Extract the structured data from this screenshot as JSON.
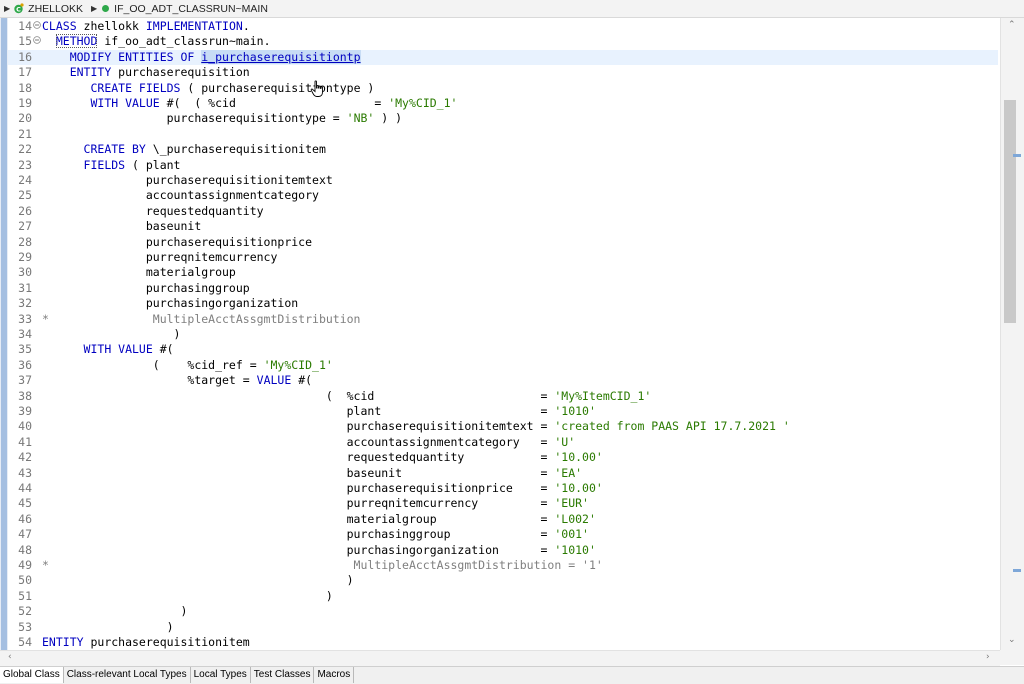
{
  "breadcrumb": {
    "class_name": "ZHELLOKK",
    "method_name": "IF_OO_ADT_CLASSRUN~MAIN"
  },
  "editor": {
    "lines": [
      {
        "n": "14",
        "fold": "minus",
        "parts": [
          {
            "t": "CLASS",
            "c": "k"
          },
          {
            "t": " zhellokk "
          },
          {
            "t": "IMPLEMENTATION",
            "c": "k"
          },
          {
            "t": "."
          }
        ]
      },
      {
        "n": "15",
        "fold": "minus",
        "parts": [
          {
            "t": "  "
          },
          {
            "t": "METHOD",
            "c": "k boxed"
          },
          {
            "t": " if_oo_adt_classrun~main."
          }
        ]
      },
      {
        "n": "16",
        "current": true,
        "parts": [
          {
            "t": "    "
          },
          {
            "t": "MODIFY ENTITIES OF",
            "c": "k"
          },
          {
            "t": " "
          },
          {
            "t": "i_purchaserequisitiontp",
            "c": "hl"
          }
        ]
      },
      {
        "n": "17",
        "parts": [
          {
            "t": "    "
          },
          {
            "t": "ENTITY",
            "c": "k"
          },
          {
            "t": " purchaserequisition"
          }
        ]
      },
      {
        "n": "18",
        "parts": [
          {
            "t": "       "
          },
          {
            "t": "CREATE FIELDS",
            "c": "k"
          },
          {
            "t": " ( purchaserequisitiontype )"
          }
        ]
      },
      {
        "n": "19",
        "parts": [
          {
            "t": "       "
          },
          {
            "t": "WITH VALUE",
            "c": "k"
          },
          {
            "t": " #(  ( %cid                    = "
          },
          {
            "t": "'My%CID_1'",
            "c": "s"
          }
        ]
      },
      {
        "n": "20",
        "parts": [
          {
            "t": "                  purchaserequisitiontype = "
          },
          {
            "t": "'NB'",
            "c": "s"
          },
          {
            "t": " ) )"
          }
        ]
      },
      {
        "n": "21",
        "parts": [
          {
            "t": ""
          }
        ]
      },
      {
        "n": "22",
        "parts": [
          {
            "t": "      "
          },
          {
            "t": "CREATE BY",
            "c": "k"
          },
          {
            "t": " \\_purchaserequisitionitem"
          }
        ]
      },
      {
        "n": "23",
        "parts": [
          {
            "t": "      "
          },
          {
            "t": "FIELDS",
            "c": "k"
          },
          {
            "t": " ( plant"
          }
        ]
      },
      {
        "n": "24",
        "parts": [
          {
            "t": "               purchaserequisitionitemtext"
          }
        ]
      },
      {
        "n": "25",
        "parts": [
          {
            "t": "               accountassignmentcategory"
          }
        ]
      },
      {
        "n": "26",
        "parts": [
          {
            "t": "               requestedquantity"
          }
        ]
      },
      {
        "n": "27",
        "parts": [
          {
            "t": "               baseunit"
          }
        ]
      },
      {
        "n": "28",
        "parts": [
          {
            "t": "               purchaserequisitionprice"
          }
        ]
      },
      {
        "n": "29",
        "parts": [
          {
            "t": "               purreqnitemcurrency"
          }
        ]
      },
      {
        "n": "30",
        "parts": [
          {
            "t": "               materialgroup"
          }
        ]
      },
      {
        "n": "31",
        "parts": [
          {
            "t": "               purchasinggroup"
          }
        ]
      },
      {
        "n": "32",
        "parts": [
          {
            "t": "               purchasingorganization"
          }
        ]
      },
      {
        "n": "33",
        "parts": [
          {
            "t": "*               MultipleAcctAssgmtDistribution",
            "c": "c"
          }
        ]
      },
      {
        "n": "34",
        "parts": [
          {
            "t": "                   )"
          }
        ]
      },
      {
        "n": "35",
        "parts": [
          {
            "t": "      "
          },
          {
            "t": "WITH VALUE",
            "c": "k"
          },
          {
            "t": " #("
          }
        ]
      },
      {
        "n": "36",
        "parts": [
          {
            "t": "                (    %cid_ref = "
          },
          {
            "t": "'My%CID_1'",
            "c": "s"
          }
        ]
      },
      {
        "n": "37",
        "parts": [
          {
            "t": "                     %target = "
          },
          {
            "t": "VALUE",
            "c": "k"
          },
          {
            "t": " #("
          }
        ]
      },
      {
        "n": "38",
        "parts": [
          {
            "t": "                                         (  %cid                        = "
          },
          {
            "t": "'My%ItemCID_1'",
            "c": "s"
          }
        ]
      },
      {
        "n": "39",
        "parts": [
          {
            "t": "                                            plant                       = "
          },
          {
            "t": "'1010'",
            "c": "s"
          }
        ]
      },
      {
        "n": "40",
        "parts": [
          {
            "t": "                                            purchaserequisitionitemtext = "
          },
          {
            "t": "'created from PAAS API 17.7.2021 '",
            "c": "s"
          }
        ]
      },
      {
        "n": "41",
        "parts": [
          {
            "t": "                                            accountassignmentcategory   = "
          },
          {
            "t": "'U'",
            "c": "s"
          }
        ]
      },
      {
        "n": "42",
        "parts": [
          {
            "t": "                                            requestedquantity           = "
          },
          {
            "t": "'10.00'",
            "c": "s"
          }
        ]
      },
      {
        "n": "43",
        "parts": [
          {
            "t": "                                            baseunit                    = "
          },
          {
            "t": "'EA'",
            "c": "s"
          }
        ]
      },
      {
        "n": "44",
        "parts": [
          {
            "t": "                                            purchaserequisitionprice    = "
          },
          {
            "t": "'10.00'",
            "c": "s"
          }
        ]
      },
      {
        "n": "45",
        "parts": [
          {
            "t": "                                            purreqnitemcurrency         = "
          },
          {
            "t": "'EUR'",
            "c": "s"
          }
        ]
      },
      {
        "n": "46",
        "parts": [
          {
            "t": "                                            materialgroup               = "
          },
          {
            "t": "'L002'",
            "c": "s"
          }
        ]
      },
      {
        "n": "47",
        "parts": [
          {
            "t": "                                            purchasinggroup             = "
          },
          {
            "t": "'001'",
            "c": "s"
          }
        ]
      },
      {
        "n": "48",
        "parts": [
          {
            "t": "                                            purchasingorganization      = "
          },
          {
            "t": "'1010'",
            "c": "s"
          }
        ]
      },
      {
        "n": "49",
        "parts": [
          {
            "t": "*                                            MultipleAcctAssgmtDistribution = '1'",
            "c": "c"
          }
        ]
      },
      {
        "n": "50",
        "parts": [
          {
            "t": "                                            )"
          }
        ]
      },
      {
        "n": "51",
        "parts": [
          {
            "t": "                                         )"
          }
        ]
      },
      {
        "n": "52",
        "parts": [
          {
            "t": "                    )"
          }
        ]
      },
      {
        "n": "53",
        "parts": [
          {
            "t": "                  )"
          }
        ]
      },
      {
        "n": "54",
        "parts": [
          {
            "t": "ENTITY",
            "c": "k"
          },
          {
            "t": " purchaserequisitionitem"
          }
        ]
      }
    ]
  },
  "bottom_tabs": [
    {
      "label": "Global Class",
      "active": true
    },
    {
      "label": "Class-relevant Local Types",
      "active": false
    },
    {
      "label": "Local Types",
      "active": false
    },
    {
      "label": "Test Classes",
      "active": false
    },
    {
      "label": "Macros",
      "active": false
    }
  ],
  "icons": {
    "class_icon": "abap-class-icon",
    "method_icon": "public-method-icon",
    "fold_icon": "fold-collapse-icon",
    "cursor": "hand-pointer-cursor"
  },
  "colors": {
    "keyword": "#0000c0",
    "string": "#2a7a00",
    "comment": "#7f7f7f",
    "current_line": "#e8f2fe",
    "selection": "#c7dcf5"
  }
}
